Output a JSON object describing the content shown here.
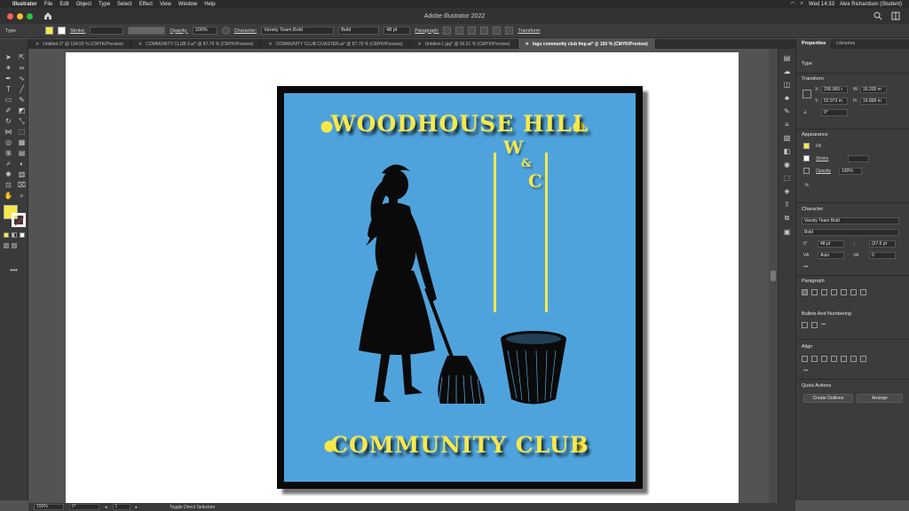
{
  "menubar": {
    "app": "Illustrator",
    "items": [
      "File",
      "Edit",
      "Object",
      "Type",
      "Select",
      "Effect",
      "View",
      "Window",
      "Help"
    ],
    "clock": "Wed 14:33",
    "user": "Alex Richardson (Student)"
  },
  "window": {
    "title": "Adobe Illustrator 2022"
  },
  "controlbar": {
    "type_label": "Type",
    "stroke_label": "Stroke:",
    "opacity_label": "Opacity:",
    "opacity_value": "100%",
    "character_label": "Character:",
    "font_family": "Varsity Team Bold",
    "font_style": "Bold",
    "font_size": "48 pt",
    "paragraph_label": "Paragraph:",
    "transform_label": "Transform"
  },
  "tabs": [
    {
      "label": "Untitled-2* @ 134.55 % (CMYK/Preview)"
    },
    {
      "label": "COMMUNITY CLUB 3.ai* @ 87.79 % (CMYK/Preview)"
    },
    {
      "label": "COMMUNITY CLUB COASTER.ai* @ 87.79 % (CMYK/Preview)"
    },
    {
      "label": "Untitled-1.jpg* @ 66.51 % (CMYK/Preview)"
    },
    {
      "label": "logo community club fmp.ai* @ 150 % (CMYK/Preview)",
      "active": true
    }
  ],
  "logo": {
    "top_text": "WOODHOUSE HILL",
    "bottom_text": "COMMUNITY CLUB",
    "wc_w": "W",
    "wc_c": "C",
    "wc_amp": "&"
  },
  "panel": {
    "tab_properties": "Properties",
    "tab_libraries": "Libraries",
    "type_head": "Type",
    "transform_head": "Transform",
    "x_label": "X:",
    "x_value": "200.965 r",
    "y_label": "Y:",
    "y_value": "52.973 m",
    "w_label": "W:",
    "w_value": "16.205 m",
    "h_label": "H:",
    "h_value": "16.899 m",
    "angle_value": "0°",
    "appearance_head": "Appearance",
    "fill_label": "Fill",
    "stroke_label": "Stroke",
    "opacity_label": "Opacity",
    "opacity_value": "100%",
    "fx_label": "fx.",
    "character_head": "Character",
    "font_family": "Varsity Team Bold",
    "font_style": "Bold",
    "font_size": "48 pt",
    "leading": "(57.6 pt",
    "kerning": "Auto",
    "tracking": "0",
    "paragraph_head": "Paragraph",
    "bullets_head": "Bullets And Numbering",
    "align_head": "Align",
    "quick_head": "Quick Actions",
    "create_outlines": "Create Outlines",
    "arrange": "Arrange"
  },
  "statusbar": {
    "zoom": "150%",
    "rotation": "0°",
    "artboard_num": "1",
    "status_text": "Toggle Direct Selection"
  },
  "colors": {
    "logo_fill": "#4fa3dc",
    "logo_text": "#f7e84a",
    "fill_swatch": "#f7e84a"
  }
}
